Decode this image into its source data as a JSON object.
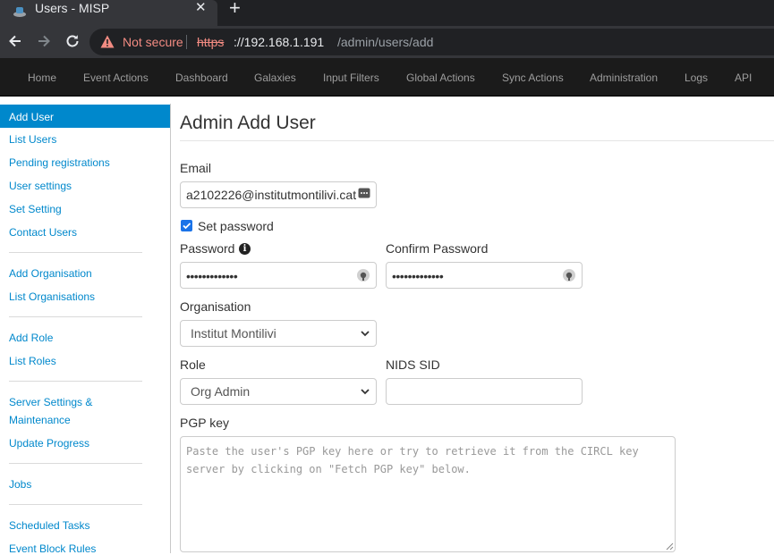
{
  "browser": {
    "tab_title": "Users - MISP",
    "tab_close": "✕",
    "new_tab": "+",
    "security_label": "Not secure",
    "url_scheme": "https",
    "url_host": "://192.168.1.191",
    "url_path": "/admin/users/add"
  },
  "nav": {
    "items": [
      "Home",
      "Event Actions",
      "Dashboard",
      "Galaxies",
      "Input Filters",
      "Global Actions",
      "Sync Actions",
      "Administration",
      "Logs",
      "API"
    ]
  },
  "sidebar": {
    "items": [
      "Add User",
      "List Users",
      "Pending registrations",
      "User settings",
      "Set Setting",
      "Contact Users",
      "Add Organisation",
      "List Organisations",
      "Add Role",
      "List Roles",
      "Server Settings &",
      "Maintenance",
      "Update Progress",
      "Jobs",
      "Scheduled Tasks",
      "Event Block Rules"
    ],
    "active": "Add User"
  },
  "form": {
    "title": "Admin Add User",
    "email_label": "Email",
    "email_value": "a2102226@institutmontilivi.cat",
    "set_password_label": "Set password",
    "set_password_checked": true,
    "password_label": "Password",
    "password_dots": "•••••••••••••",
    "confirm_password_label": "Confirm Password",
    "confirm_password_dots": "•••••••••••••",
    "organisation_label": "Organisation",
    "organisation_value": "Institut Montilivi",
    "role_label": "Role",
    "role_value": "Org Admin",
    "nids_sid_label": "NIDS SID",
    "nids_sid_value": "",
    "pgp_label": "PGP key",
    "pgp_placeholder": "Paste the user's PGP key here or try to retrieve it from the CIRCL key server by clicking on \"Fetch PGP key\" below."
  },
  "icons": {
    "favicon": "misp-favicon-icon",
    "warning": "warning-triangle-icon",
    "info": "info-circle-icon",
    "reveal": "password-reveal-icon",
    "autofill": "password-manager-icon",
    "caret": "chevron-down-icon"
  },
  "colors": {
    "nav_bg": "#1b1b1b",
    "nav_text": "#9d9d9d",
    "link": "#0088cc",
    "active_bg": "#0088cc",
    "checkbox": "#1a73e8",
    "not_secure": "#f28b82"
  }
}
